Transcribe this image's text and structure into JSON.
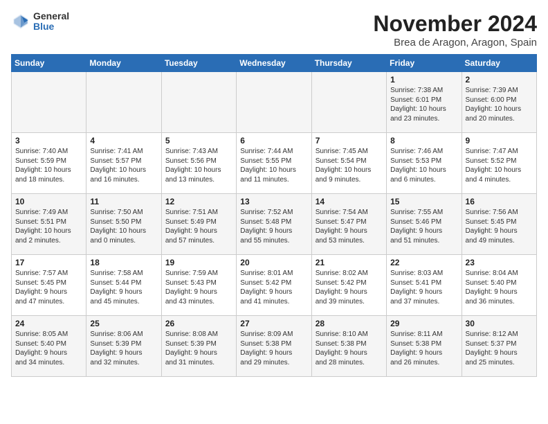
{
  "logo": {
    "general": "General",
    "blue": "Blue"
  },
  "header": {
    "month": "November 2024",
    "location": "Brea de Aragon, Aragon, Spain"
  },
  "weekdays": [
    "Sunday",
    "Monday",
    "Tuesday",
    "Wednesday",
    "Thursday",
    "Friday",
    "Saturday"
  ],
  "weeks": [
    [
      {
        "day": "",
        "info": ""
      },
      {
        "day": "",
        "info": ""
      },
      {
        "day": "",
        "info": ""
      },
      {
        "day": "",
        "info": ""
      },
      {
        "day": "",
        "info": ""
      },
      {
        "day": "1",
        "info": "Sunrise: 7:38 AM\nSunset: 6:01 PM\nDaylight: 10 hours\nand 23 minutes."
      },
      {
        "day": "2",
        "info": "Sunrise: 7:39 AM\nSunset: 6:00 PM\nDaylight: 10 hours\nand 20 minutes."
      }
    ],
    [
      {
        "day": "3",
        "info": "Sunrise: 7:40 AM\nSunset: 5:59 PM\nDaylight: 10 hours\nand 18 minutes."
      },
      {
        "day": "4",
        "info": "Sunrise: 7:41 AM\nSunset: 5:57 PM\nDaylight: 10 hours\nand 16 minutes."
      },
      {
        "day": "5",
        "info": "Sunrise: 7:43 AM\nSunset: 5:56 PM\nDaylight: 10 hours\nand 13 minutes."
      },
      {
        "day": "6",
        "info": "Sunrise: 7:44 AM\nSunset: 5:55 PM\nDaylight: 10 hours\nand 11 minutes."
      },
      {
        "day": "7",
        "info": "Sunrise: 7:45 AM\nSunset: 5:54 PM\nDaylight: 10 hours\nand 9 minutes."
      },
      {
        "day": "8",
        "info": "Sunrise: 7:46 AM\nSunset: 5:53 PM\nDaylight: 10 hours\nand 6 minutes."
      },
      {
        "day": "9",
        "info": "Sunrise: 7:47 AM\nSunset: 5:52 PM\nDaylight: 10 hours\nand 4 minutes."
      }
    ],
    [
      {
        "day": "10",
        "info": "Sunrise: 7:49 AM\nSunset: 5:51 PM\nDaylight: 10 hours\nand 2 minutes."
      },
      {
        "day": "11",
        "info": "Sunrise: 7:50 AM\nSunset: 5:50 PM\nDaylight: 10 hours\nand 0 minutes."
      },
      {
        "day": "12",
        "info": "Sunrise: 7:51 AM\nSunset: 5:49 PM\nDaylight: 9 hours\nand 57 minutes."
      },
      {
        "day": "13",
        "info": "Sunrise: 7:52 AM\nSunset: 5:48 PM\nDaylight: 9 hours\nand 55 minutes."
      },
      {
        "day": "14",
        "info": "Sunrise: 7:54 AM\nSunset: 5:47 PM\nDaylight: 9 hours\nand 53 minutes."
      },
      {
        "day": "15",
        "info": "Sunrise: 7:55 AM\nSunset: 5:46 PM\nDaylight: 9 hours\nand 51 minutes."
      },
      {
        "day": "16",
        "info": "Sunrise: 7:56 AM\nSunset: 5:45 PM\nDaylight: 9 hours\nand 49 minutes."
      }
    ],
    [
      {
        "day": "17",
        "info": "Sunrise: 7:57 AM\nSunset: 5:45 PM\nDaylight: 9 hours\nand 47 minutes."
      },
      {
        "day": "18",
        "info": "Sunrise: 7:58 AM\nSunset: 5:44 PM\nDaylight: 9 hours\nand 45 minutes."
      },
      {
        "day": "19",
        "info": "Sunrise: 7:59 AM\nSunset: 5:43 PM\nDaylight: 9 hours\nand 43 minutes."
      },
      {
        "day": "20",
        "info": "Sunrise: 8:01 AM\nSunset: 5:42 PM\nDaylight: 9 hours\nand 41 minutes."
      },
      {
        "day": "21",
        "info": "Sunrise: 8:02 AM\nSunset: 5:42 PM\nDaylight: 9 hours\nand 39 minutes."
      },
      {
        "day": "22",
        "info": "Sunrise: 8:03 AM\nSunset: 5:41 PM\nDaylight: 9 hours\nand 37 minutes."
      },
      {
        "day": "23",
        "info": "Sunrise: 8:04 AM\nSunset: 5:40 PM\nDaylight: 9 hours\nand 36 minutes."
      }
    ],
    [
      {
        "day": "24",
        "info": "Sunrise: 8:05 AM\nSunset: 5:40 PM\nDaylight: 9 hours\nand 34 minutes."
      },
      {
        "day": "25",
        "info": "Sunrise: 8:06 AM\nSunset: 5:39 PM\nDaylight: 9 hours\nand 32 minutes."
      },
      {
        "day": "26",
        "info": "Sunrise: 8:08 AM\nSunset: 5:39 PM\nDaylight: 9 hours\nand 31 minutes."
      },
      {
        "day": "27",
        "info": "Sunrise: 8:09 AM\nSunset: 5:38 PM\nDaylight: 9 hours\nand 29 minutes."
      },
      {
        "day": "28",
        "info": "Sunrise: 8:10 AM\nSunset: 5:38 PM\nDaylight: 9 hours\nand 28 minutes."
      },
      {
        "day": "29",
        "info": "Sunrise: 8:11 AM\nSunset: 5:38 PM\nDaylight: 9 hours\nand 26 minutes."
      },
      {
        "day": "30",
        "info": "Sunrise: 8:12 AM\nSunset: 5:37 PM\nDaylight: 9 hours\nand 25 minutes."
      }
    ]
  ]
}
